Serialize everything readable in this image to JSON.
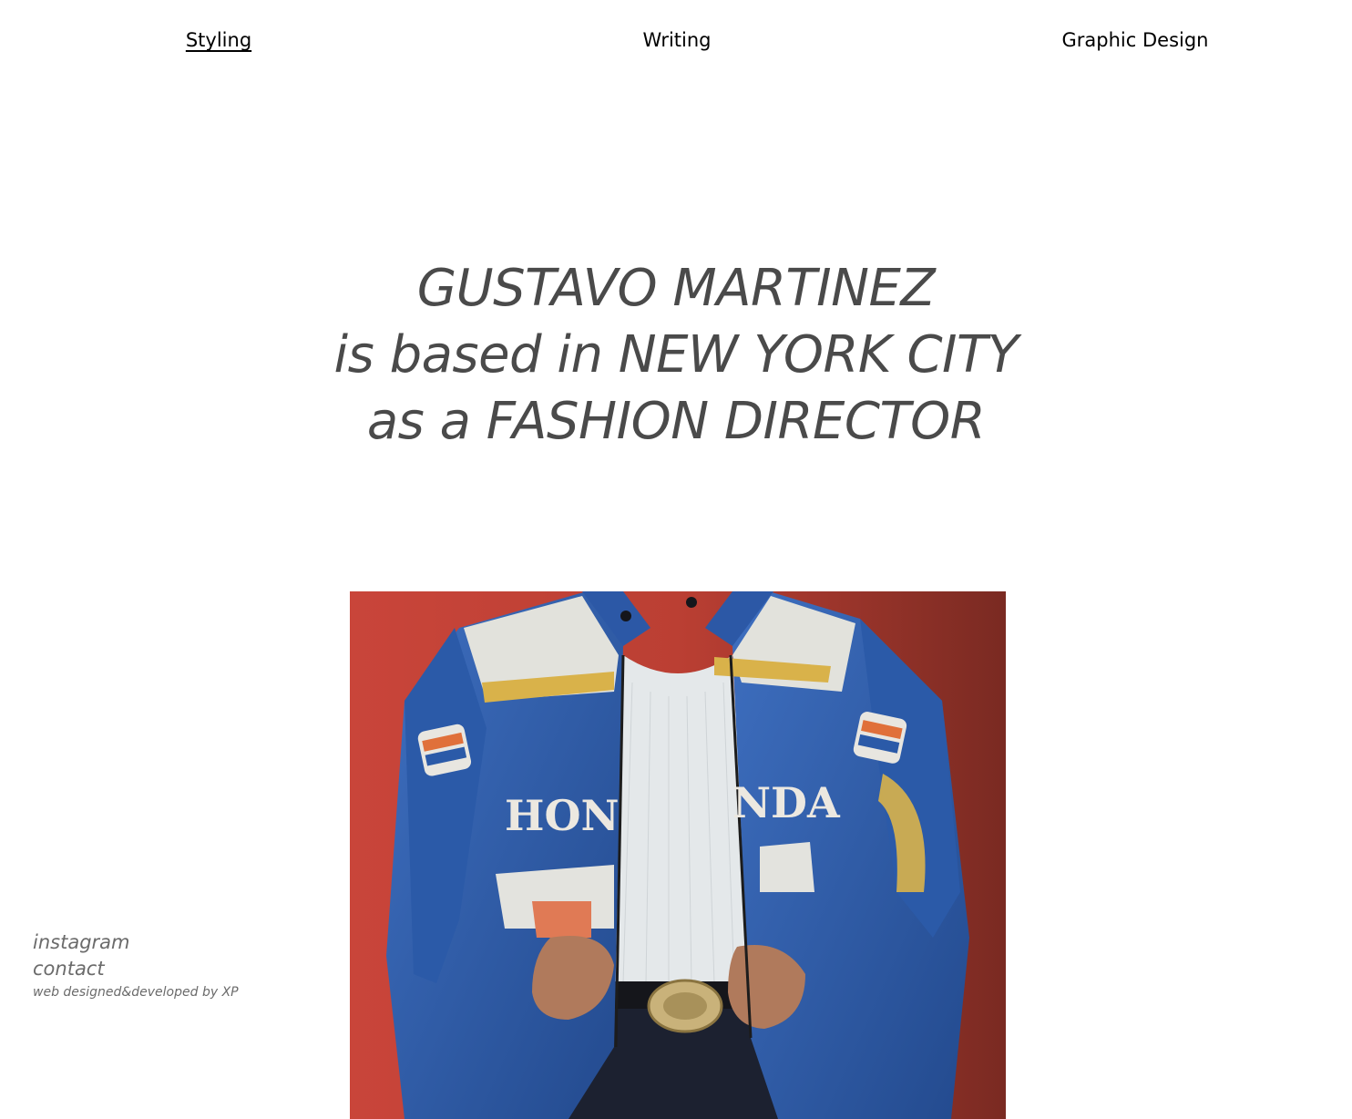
{
  "nav": {
    "items": [
      {
        "label": "Styling",
        "active": true
      },
      {
        "label": "Writing",
        "active": false
      },
      {
        "label": "Graphic Design",
        "active": false
      }
    ]
  },
  "hero": {
    "lines": [
      "GUSTAVO MARTINEZ",
      "is based in NEW YORK CITY",
      "as a FASHION DIRECTOR"
    ]
  },
  "photo": {
    "jacket_text_left": "HON",
    "jacket_text_right": "NDA",
    "background_color": "#b8473c",
    "jacket_color": "#2f5fae"
  },
  "footer": {
    "instagram_label": "instagram",
    "contact_label": "contact",
    "credit": "web designed&developed by XP"
  }
}
